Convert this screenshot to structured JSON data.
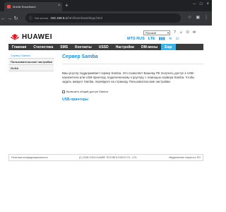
{
  "browser": {
    "tab_title": "Mobile Broadband",
    "tab_close": "×",
    "new_tab": "+",
    "not_secure": "Not secure",
    "url_host": "192.168.8.1",
    "url_path": "/html/sambasettings.html",
    "nav_back": "←",
    "nav_forward": "→",
    "nav_reload": "↻"
  },
  "header": {
    "brand": "HUAWEI",
    "language": "Русский",
    "operator": "MTS RUS",
    "network": "LTE",
    "signal_icon": "▮▮▮",
    "battery_icon": "▭"
  },
  "nav": {
    "items": [
      {
        "label": "Главная"
      },
      {
        "label": "Статистика"
      },
      {
        "label": "SMS"
      },
      {
        "label": "Контакты"
      },
      {
        "label": "USSD"
      },
      {
        "label": "Настройки"
      },
      {
        "label": "DM-мены"
      },
      {
        "label": "Еще"
      }
    ]
  },
  "sidebar": {
    "items": [
      {
        "label": "Сервер Samba"
      },
      {
        "label": "Пользовательские настройки"
      },
      {
        "label": "DLNA"
      }
    ]
  },
  "main": {
    "title": "Сервер Samba",
    "description": "Ваш роутер поддерживает сервер Samba. Это позволяет Вашему ПК получить доступ к USB-накопителю или USB-принтеру, подключенному к роутеру, с помощью сервера Samba. Чтобы задать аккаунт Samba, перейдите на страницу Пользовательские настройки.",
    "checkbox_label": "Включить общий доступ Samba",
    "printers_link": "USB-принтеры"
  },
  "footer": {
    "left": "Политика конфиденциальности",
    "center": "(C) 2006-2016 HUAWEI TECHNOLOGIES CO., LTD.",
    "right": "Уведомление открытого ПО"
  },
  "colors": {
    "accent": "#1f8fd2",
    "nav_bg": "#3c3c3c",
    "nav_active": "#3eb1e3",
    "brand_red": "#d7000f"
  }
}
